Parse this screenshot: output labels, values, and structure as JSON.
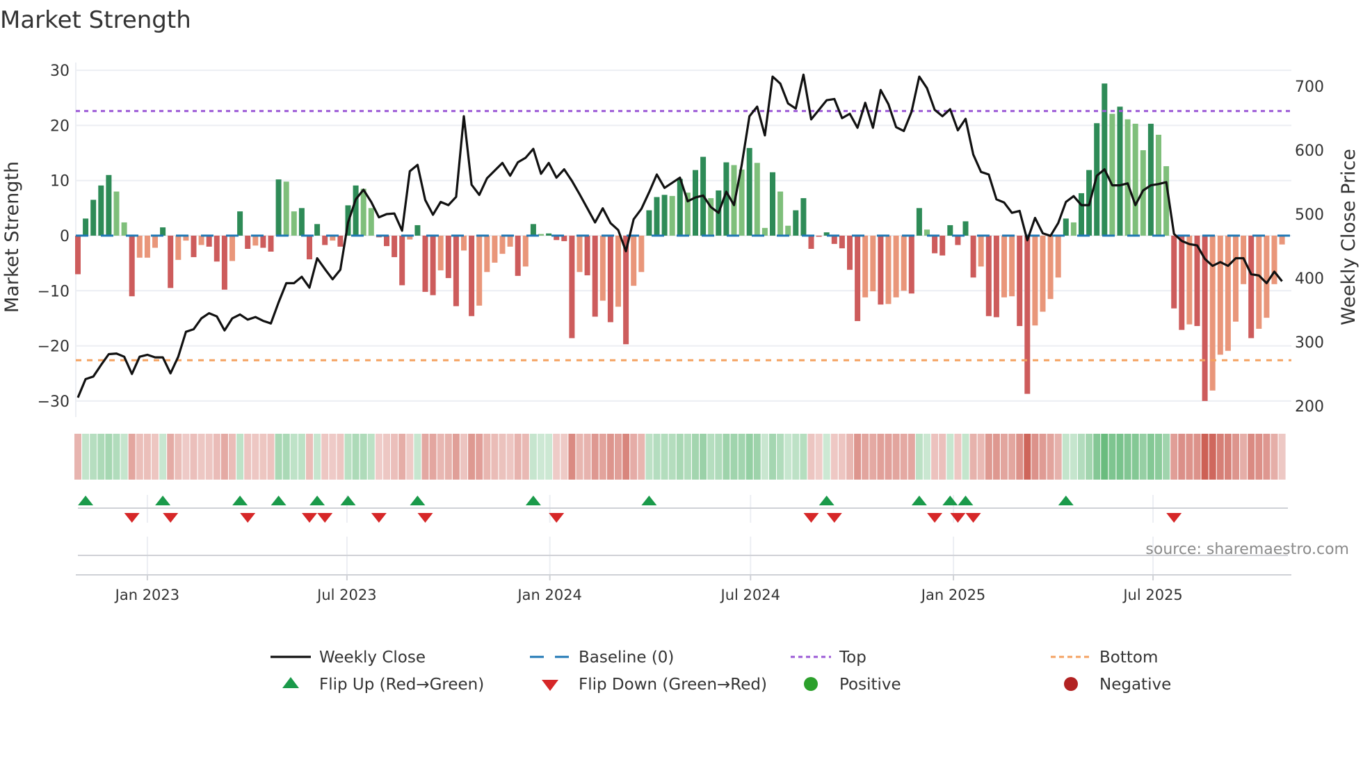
{
  "chart_data": {
    "type": "bar",
    "title": "Market Strength",
    "ylabel": "Market Strength",
    "y2label": "Weekly Close Price",
    "ylim": [
      -31.5,
      31.5
    ],
    "y2lim": [
      200,
      700
    ],
    "yticks": [
      "30",
      "20",
      "10",
      "0",
      "−10",
      "−20",
      "−30"
    ],
    "ytick_values": [
      30,
      20,
      10,
      0,
      -10,
      -20,
      -30
    ],
    "y2ticks": [
      "700",
      "600",
      "500",
      "400",
      "300",
      "200"
    ],
    "y2tick_values": [
      700,
      600,
      500,
      400,
      300,
      200
    ],
    "x_start_date": "2022-10-30",
    "x_frequency": "weekly",
    "xticks": [
      {
        "label": "Jan 2023",
        "date": "2023-01-01"
      },
      {
        "label": "Jul 2023",
        "date": "2023-07-01"
      },
      {
        "label": "Jan 2024",
        "date": "2024-01-01"
      },
      {
        "label": "Jul 2024",
        "date": "2024-07-01"
      },
      {
        "label": "Jan 2025",
        "date": "2025-01-01"
      },
      {
        "label": "Jul 2025",
        "date": "2025-07-01"
      }
    ],
    "top_level": 22.6,
    "bottom_level": -22.6,
    "baseline": 0,
    "strength": [
      -7.0,
      3.1,
      6.5,
      9.1,
      11.0,
      8.0,
      2.4,
      -11.0,
      -4.0,
      -4.0,
      -2.2,
      1.5,
      -9.5,
      -4.4,
      -0.9,
      -3.9,
      -1.7,
      -2.0,
      -4.7,
      -9.8,
      -4.6,
      4.4,
      -2.4,
      -1.8,
      -2.2,
      -2.9,
      10.2,
      9.8,
      4.4,
      5.0,
      -4.3,
      2.1,
      -1.7,
      -0.9,
      -2.0,
      5.5,
      9.1,
      8.5,
      5.0,
      -0.3,
      -1.9,
      -3.9,
      -9.0,
      -0.7,
      1.9,
      -10.2,
      -10.8,
      -6.3,
      -7.7,
      -12.8,
      -2.7,
      -14.6,
      -12.7,
      -6.6,
      -4.9,
      -3.3,
      -2.0,
      -7.3,
      -5.6,
      2.1,
      0.3,
      0.4,
      -0.8,
      -1.0,
      -18.6,
      -6.6,
      -7.2,
      -14.7,
      -11.8,
      -15.7,
      -12.9,
      -19.7,
      -9.1,
      -6.6,
      4.6,
      7.0,
      7.4,
      7.2,
      10.3,
      7.8,
      11.9,
      14.3,
      6.8,
      8.2,
      13.3,
      12.8,
      12.0,
      15.9,
      13.2,
      1.4,
      11.5,
      8.0,
      1.8,
      4.6,
      6.8,
      -2.4,
      -0.2,
      0.6,
      -1.5,
      -2.3,
      -6.2,
      -15.5,
      -11.2,
      -10.1,
      -12.5,
      -12.4,
      -11.2,
      -10.0,
      -10.5,
      5.0,
      1.1,
      -3.2,
      -3.6,
      1.9,
      -1.7,
      2.6,
      -7.6,
      -5.6,
      -14.6,
      -14.8,
      -11.2,
      -11.0,
      -16.4,
      -28.7,
      -16.3,
      -13.8,
      -11.5,
      -7.6,
      3.1,
      2.4,
      7.7,
      11.9,
      20.4,
      27.6,
      22.1,
      23.4,
      21.1,
      20.3,
      15.5,
      20.3,
      18.3,
      12.6,
      -13.2,
      -17.1,
      -16.1,
      -16.4,
      -30.0,
      -28.1,
      -21.6,
      -20.9,
      -15.6,
      -8.8,
      -18.6,
      -16.9,
      -14.9,
      -8.8,
      -1.6
    ],
    "bar_shade": "RGGGGggRrrrGRrrRrRRRrGRrRRGggGRGRrRGGggRRRRrGRRrRRrRrrrrrRrGgGRRRrRRrRrRrrGGGgGgGGgGGggGggGggGGRRGRRRRrrRrrrRGgRRGRGRrRRrrRRrrrrGgGGGGgGgggGggRRrRRrrrrrRrrrr",
    "bar_shade_key": {
      "G": "positive-strengthening",
      "g": "positive-weakening",
      "R": "negative-weakening",
      "r": "negative-recovering"
    },
    "weekly_close": [
      213,
      242,
      246,
      264,
      281,
      282,
      277,
      250,
      277,
      280,
      276,
      276,
      251,
      277,
      316,
      320,
      337,
      345,
      340,
      318,
      337,
      343,
      335,
      339,
      333,
      329,
      362,
      392,
      392,
      402,
      385,
      431,
      414,
      398,
      413,
      487,
      523,
      538,
      519,
      495,
      500,
      501,
      474,
      567,
      577,
      522,
      499,
      519,
      514,
      527,
      653,
      546,
      530,
      556,
      568,
      580,
      560,
      581,
      588,
      602,
      563,
      580,
      557,
      570,
      552,
      531,
      509,
      487,
      509,
      486,
      475,
      442,
      492,
      508,
      534,
      562,
      541,
      549,
      557,
      520,
      526,
      529,
      511,
      502,
      535,
      514,
      577,
      653,
      668,
      623,
      715,
      704,
      673,
      665,
      718,
      648,
      663,
      678,
      680,
      650,
      657,
      635,
      674,
      635,
      694,
      672,
      636,
      630,
      660,
      715,
      697,
      663,
      653,
      664,
      631,
      649,
      593,
      566,
      562,
      523,
      518,
      502,
      505,
      459,
      494,
      470,
      466,
      486,
      519,
      528,
      514,
      514,
      560,
      570,
      545,
      545,
      548,
      514,
      537,
      545,
      547,
      550,
      469,
      458,
      453,
      451,
      430,
      419,
      425,
      419,
      431,
      431,
      406,
      404,
      392,
      410,
      395
    ],
    "flip_up_weeks": [
      1,
      11,
      21,
      26,
      31,
      35,
      44,
      59,
      74,
      97,
      109,
      113,
      115,
      128
    ],
    "flip_down_weeks": [
      7,
      12,
      22,
      30,
      32,
      39,
      45,
      62,
      95,
      98,
      111,
      114,
      116,
      142
    ],
    "legend": {
      "placement": "bottom",
      "items": [
        {
          "label": "Weekly Close",
          "kind": "line"
        },
        {
          "label": "Baseline (0)",
          "kind": "dash"
        },
        {
          "label": "Top",
          "kind": "dot-purple"
        },
        {
          "label": "Bottom",
          "kind": "dot-orange"
        },
        {
          "label": "Flip Up (Red→Green)",
          "kind": "tri-up"
        },
        {
          "label": "Flip Down (Green→Red)",
          "kind": "tri-down"
        },
        {
          "label": "Positive",
          "kind": "circle-green"
        },
        {
          "label": "Negative",
          "kind": "circle-red"
        }
      ]
    },
    "annotation": "source: sharemaestro.com",
    "colors": {
      "G": "#2e8b57",
      "g": "#7fbf7b",
      "R": "#cd5c5c",
      "r": "#e9967a",
      "price": "#111111",
      "baseline": "#1f77b4",
      "top": "#9b59d6",
      "bottom": "#f4a261",
      "flip_up": "#1a9a4a",
      "flip_down": "#d62728",
      "positive": "#2ca02c",
      "negative": "#b22222",
      "grid": "#eceef3",
      "axis": "#cfd1d6"
    }
  }
}
